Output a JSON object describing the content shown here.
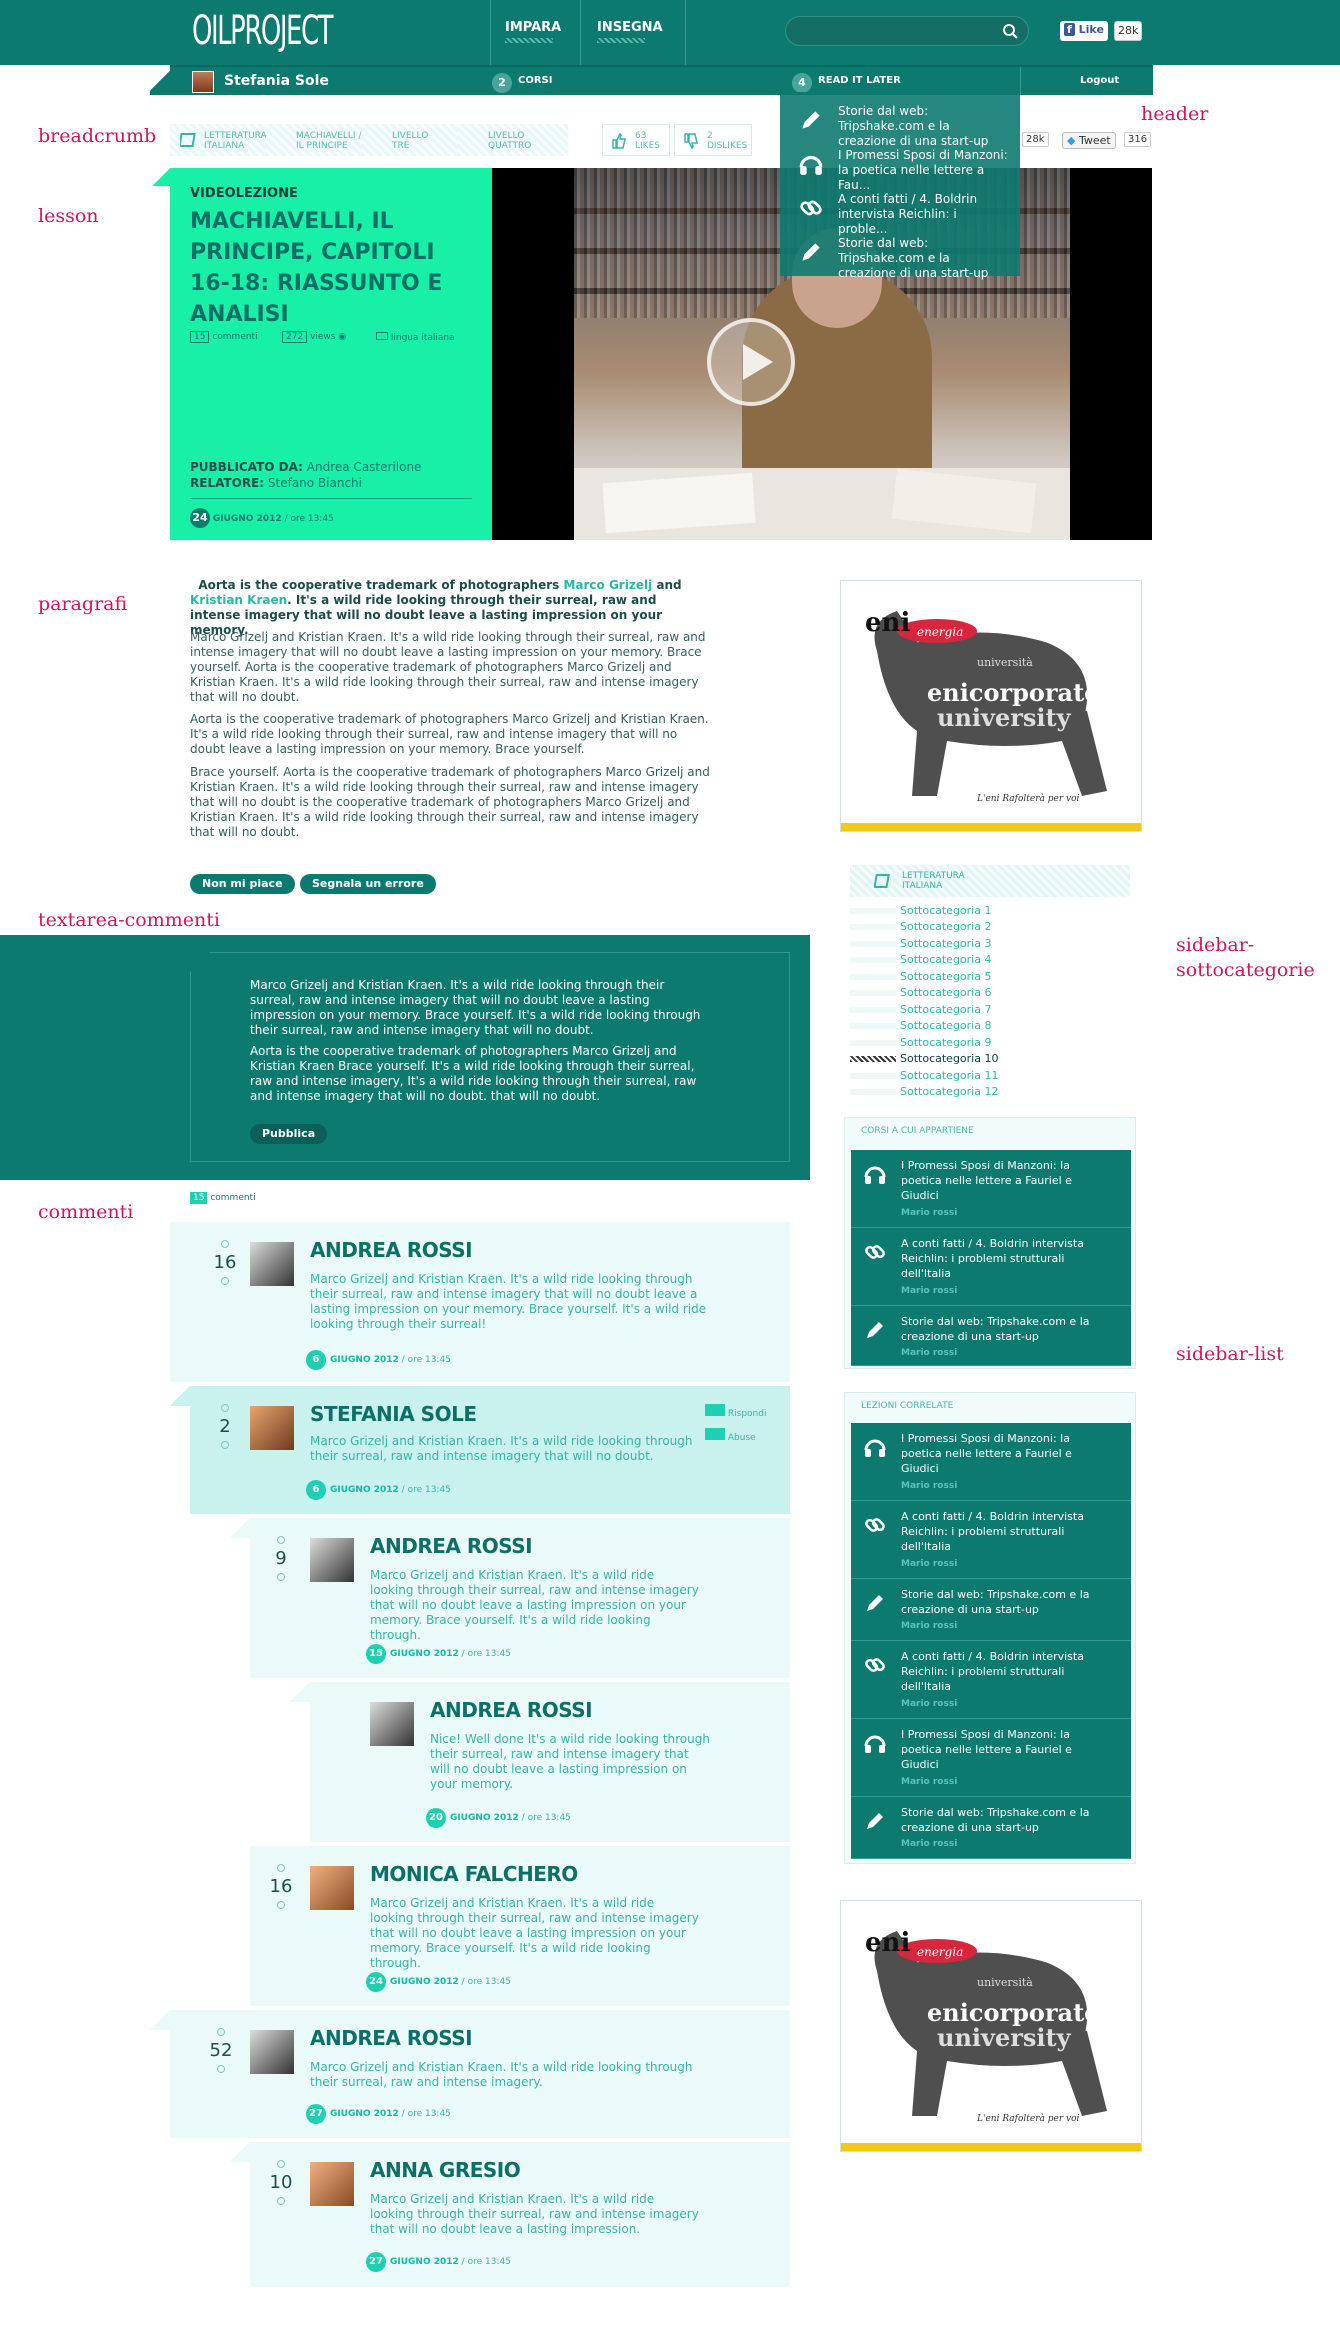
{
  "annotations": {
    "header": "header",
    "breadcrumb": "breadcrumb",
    "lesson": "lesson",
    "paragrafi": "paragrafi",
    "textarea": "textarea-commenti",
    "commenti": "commenti",
    "sidebar_sc_1": "sidebar-",
    "sidebar_sc_2": "sottocategorie",
    "sidebar_list": "sidebar-list"
  },
  "header": {
    "logo": "OILPROJECT",
    "nav": [
      "IMPARA",
      "INSEGNA"
    ],
    "search_placeholder": "",
    "fb_like": "Like",
    "fb_count": "28k"
  },
  "userbar": {
    "username": "Stefania Sole",
    "corsi_count": "2",
    "corsi_label": "CORSI",
    "read_count": "4",
    "read_label": "READ IT LATER",
    "logout": "Logout"
  },
  "read_later": [
    {
      "icon": "pencil",
      "text": "Storie dal web: Tripshake.com e la creazione di una start-up"
    },
    {
      "icon": "headphones",
      "text": "I Promessi Sposi di Manzoni: la poetica nelle lettere a Fau..."
    },
    {
      "icon": "link",
      "text": "A conti fatti / 4. Boldrin intervista Reichlin: i proble..."
    },
    {
      "icon": "pencil",
      "text": "Storie dal web: Tripshake.com e la creazione di una start-up"
    }
  ],
  "breadcrumb": {
    "items": [
      "LETTERATURA ITALIANA",
      "MACHIAVELLI / IL PRINCIPE",
      "LIVELLO TRE",
      "LIVELLO QUATTRO"
    ],
    "likes_count": "63",
    "likes_label": "LIKES",
    "dislikes_count": "2",
    "dislikes_label": "DISLIKES",
    "fb_count": "28k",
    "tweet": "Tweet",
    "tweet_count": "316"
  },
  "lesson": {
    "kicker": "VIDEOLEZIONE",
    "title": "MACHIAVELLI, IL PRINCIPE, CAPITOLI 16-18: RIASSUNTO E ANALISI",
    "comments_count": "15",
    "comments_label": "commenti",
    "views_count": "272",
    "views_label": "views",
    "language": "lingua italiana",
    "published_label": "PUBBLICATO DA:",
    "published_by": "Andrea Casterilone",
    "speaker_label": "RELATORE:",
    "speaker": "Stefano Bianchi",
    "day": "24",
    "month_year": "GIUGNO 2012",
    "time": "/ ore 13:45"
  },
  "paragrafi": {
    "lead_pre": "Aorta is the cooperative trademark of photographers ",
    "lead_link1": "Marco Grizelj",
    "lead_mid": " and ",
    "lead_link2": "Kristian Kraen",
    "lead_post": ". It's a wild ride looking through their surreal, raw and intense imagery that will no doubt leave a lasting impression on your memory.",
    "p1": "Marco Grizelj and Kristian Kraen. It's a wild ride looking through their surreal, raw and intense imagery that will no doubt leave a lasting impression on your memory. Brace yourself. Aorta is the cooperative trademark of photographers Marco Grizelj and Kristian Kraen. It's a wild ride looking through their surreal, raw and intense imagery that will no doubt.",
    "p2": "Aorta is the cooperative trademark of photographers Marco Grizelj and Kristian Kraen. It's a wild ride looking through their surreal, raw and intense imagery that will no doubt leave a lasting impression on your memory. Brace yourself.",
    "p3": "Brace yourself. Aorta is the cooperative trademark of photographers Marco Grizelj and Kristian Kraen. It's a wild ride looking through their surreal, raw and intense imagery that will no doubt is the cooperative trademark of photographers Marco Grizelj and Kristian Kraen. It's a wild ride looking through their surreal, raw and intense imagery that will no doubt.",
    "dislike_btn": "Non mi piace",
    "report_btn": "Segnala un errore"
  },
  "ad": {
    "brand1": "eni",
    "brand2": "energia",
    "brand3": "enicorporate",
    "brand4": "university",
    "brand5": "università",
    "tagline": "L'eni Rafolterà per voi"
  },
  "textarea": {
    "t1": "Marco Grizelj and Kristian Kraen. It's a wild ride looking through their surreal, raw and intense imagery that will no doubt leave a lasting impression on your memory. Brace yourself. It's a wild ride looking through their surreal, raw and intense imagery that will no doubt.",
    "t2": "Aorta is the cooperative trademark of photographers Marco Grizelj and Kristian Kraen Brace yourself. It's a wild ride looking through their surreal, raw and intense imagery, It's a wild ride looking through their surreal, raw and intense imagery that will no doubt. that will no doubt.",
    "publish": "Pubblica"
  },
  "comments_header": {
    "count": "15",
    "label": "commenti"
  },
  "comments": [
    {
      "votes": "16",
      "name": "ANDREA ROSSI",
      "text": "Marco Grizelj and Kristian Kraen. It's a wild ride looking through their surreal, raw and intense imagery that will no doubt leave a lasting impression on your memory. Brace yourself. It's a wild ride looking through their surreal!",
      "day": "6",
      "month": "GIUGNO 2012",
      "time": "/ ore 13:45"
    },
    {
      "votes": "2",
      "name": "STEFANIA SOLE",
      "text": "Marco Grizelj and Kristian Kraen. It's a wild ride looking through their surreal, raw and intense imagery that will no doubt.",
      "day": "6",
      "month": "GIUGNO 2012",
      "time": "/ ore 13:45",
      "reply": "Rispondi",
      "abuse": "Abuse"
    },
    {
      "votes": "9",
      "name": "ANDREA ROSSI",
      "text": "Marco Grizelj and Kristian Kraen. It's a wild ride looking through their surreal, raw and intense imagery that will no doubt leave a lasting impression on your memory. Brace yourself. It's a wild ride looking through.",
      "day": "15",
      "month": "GIUGNO 2012",
      "time": "/ ore 13:45"
    },
    {
      "votes": "",
      "name": "ANDREA ROSSI",
      "text": "Nice! Well done It's a wild ride looking through their surreal, raw and intense imagery that will no doubt leave a lasting impression on your memory.",
      "day": "20",
      "month": "GIUGNO 2012",
      "time": "/ ore 13:45"
    },
    {
      "votes": "16",
      "name": "MONICA FALCHERO",
      "text": "Marco Grizelj and Kristian Kraen. It's a wild ride looking through their surreal, raw and intense imagery that will no doubt leave a lasting impression on your memory. Brace yourself. It's a wild ride looking through.",
      "day": "24",
      "month": "GIUGNO 2012",
      "time": "/ ore 13:45"
    },
    {
      "votes": "52",
      "name": "ANDREA ROSSI",
      "text": "Marco Grizelj and Kristian Kraen. It's a wild ride looking through their surreal, raw and intense imagery.",
      "day": "27",
      "month": "GIUGNO 2012",
      "time": "/ ore 13:45"
    },
    {
      "votes": "10",
      "name": "ANNA GRESIO",
      "text": "Marco Grizelj and Kristian Kraen. It's a wild ride looking through their surreal, raw and intense imagery that will no doubt leave a lasting impression.",
      "day": "27",
      "month": "GIUGNO 2012",
      "time": "/ ore 13:45"
    }
  ],
  "sottocategorie": {
    "head": "LETTERATURA ITALIANA",
    "items": [
      "Sottocategoria 1",
      "Sottocategoria 2",
      "Sottocategoria 3",
      "Sottocategoria 4",
      "Sottocategoria 5",
      "Sottocategoria 6",
      "Sottocategoria 7",
      "Sottocategoria 8",
      "Sottocategoria 9",
      "Sottocategoria 10",
      "Sottocategoria 11",
      "Sottocategoria 12"
    ]
  },
  "corsi": {
    "title": "CORSI A CUI APPARTIENE",
    "rows": [
      {
        "icon": "headphones",
        "text": "I Promessi Sposi di Manzoni: la poetica nelle lettere a Fauriel e Giudici",
        "author": "Mario rossi"
      },
      {
        "icon": "link",
        "text": "A conti fatti / 4. Boldrin intervista Reichlin: i problemi strutturali dell'Italia",
        "author": "Mario rossi"
      },
      {
        "icon": "pencil",
        "text": "Storie dal web: Tripshake.com e la creazione di una start-up",
        "author": "Mario rossi"
      }
    ]
  },
  "lezioni": {
    "title": "LEZIONI CORRELATE",
    "rows": [
      {
        "icon": "headphones",
        "text": "I Promessi Sposi di Manzoni: la poetica nelle lettere a Fauriel e Giudici",
        "author": "Mario rossi"
      },
      {
        "icon": "link",
        "text": "A conti fatti / 4. Boldrin intervista Reichlin: i problemi strutturali dell'Italia",
        "author": "Mario rossi"
      },
      {
        "icon": "pencil",
        "text": "Storie dal web: Tripshake.com e la creazione di una start-up",
        "author": "Mario rossi"
      },
      {
        "icon": "link",
        "text": "A conti fatti / 4. Boldrin intervista Reichlin: i problemi strutturali dell'Italia",
        "author": "Mario rossi"
      },
      {
        "icon": "headphones",
        "text": "I Promessi Sposi di Manzoni: la poetica nelle lettere a Fauriel e Giudici",
        "author": "Mario rossi"
      },
      {
        "icon": "pencil",
        "text": "Storie dal web: Tripshake.com e la creazione di una start-up",
        "author": "Mario rossi"
      }
    ]
  }
}
